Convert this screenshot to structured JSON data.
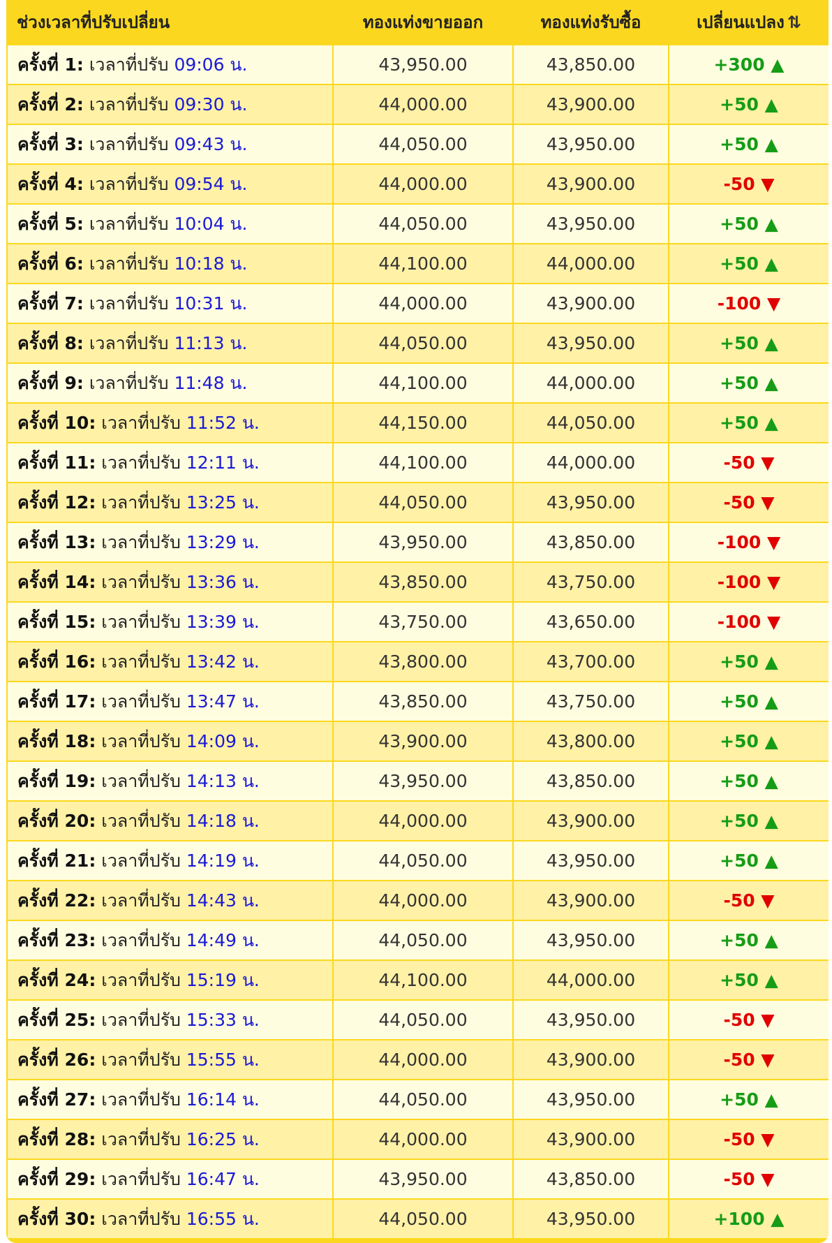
{
  "header": {
    "period": "ช่วงเวลาที่ปรับเปลี่ยน",
    "sell": "ทองแท่งขายออก",
    "buy": "ทองแท่งรับซื้อ",
    "change": "เปลี่ยนแปลง",
    "sort_icon": "⇅"
  },
  "colors": {
    "header_bg": "#fbd81f",
    "row_light": "#fffde0",
    "row_dark": "#fff1a6",
    "up": "#169c16",
    "down": "#e00000",
    "time": "#1a1ad6"
  },
  "time_label": "เวลาที่ปรับ",
  "rows": [
    {
      "round": "ครั้งที่ 1:",
      "time": "09:06 น.",
      "sell": "43,950.00",
      "buy": "43,850.00",
      "change": "+300 ▲",
      "dir": "up"
    },
    {
      "round": "ครั้งที่ 2:",
      "time": "09:30 น.",
      "sell": "44,000.00",
      "buy": "43,900.00",
      "change": "+50 ▲",
      "dir": "up"
    },
    {
      "round": "ครั้งที่ 3:",
      "time": "09:43 น.",
      "sell": "44,050.00",
      "buy": "43,950.00",
      "change": "+50 ▲",
      "dir": "up"
    },
    {
      "round": "ครั้งที่ 4:",
      "time": "09:54 น.",
      "sell": "44,000.00",
      "buy": "43,900.00",
      "change": "-50 ▼",
      "dir": "down"
    },
    {
      "round": "ครั้งที่ 5:",
      "time": "10:04 น.",
      "sell": "44,050.00",
      "buy": "43,950.00",
      "change": "+50 ▲",
      "dir": "up"
    },
    {
      "round": "ครั้งที่ 6:",
      "time": "10:18 น.",
      "sell": "44,100.00",
      "buy": "44,000.00",
      "change": "+50 ▲",
      "dir": "up"
    },
    {
      "round": "ครั้งที่ 7:",
      "time": "10:31 น.",
      "sell": "44,000.00",
      "buy": "43,900.00",
      "change": "-100 ▼",
      "dir": "down"
    },
    {
      "round": "ครั้งที่ 8:",
      "time": "11:13 น.",
      "sell": "44,050.00",
      "buy": "43,950.00",
      "change": "+50 ▲",
      "dir": "up"
    },
    {
      "round": "ครั้งที่ 9:",
      "time": "11:48 น.",
      "sell": "44,100.00",
      "buy": "44,000.00",
      "change": "+50 ▲",
      "dir": "up"
    },
    {
      "round": "ครั้งที่ 10:",
      "time": "11:52 น.",
      "sell": "44,150.00",
      "buy": "44,050.00",
      "change": "+50 ▲",
      "dir": "up"
    },
    {
      "round": "ครั้งที่ 11:",
      "time": "12:11 น.",
      "sell": "44,100.00",
      "buy": "44,000.00",
      "change": "-50 ▼",
      "dir": "down"
    },
    {
      "round": "ครั้งที่ 12:",
      "time": "13:25 น.",
      "sell": "44,050.00",
      "buy": "43,950.00",
      "change": "-50 ▼",
      "dir": "down"
    },
    {
      "round": "ครั้งที่ 13:",
      "time": "13:29 น.",
      "sell": "43,950.00",
      "buy": "43,850.00",
      "change": "-100 ▼",
      "dir": "down"
    },
    {
      "round": "ครั้งที่ 14:",
      "time": "13:36 น.",
      "sell": "43,850.00",
      "buy": "43,750.00",
      "change": "-100 ▼",
      "dir": "down"
    },
    {
      "round": "ครั้งที่ 15:",
      "time": "13:39 น.",
      "sell": "43,750.00",
      "buy": "43,650.00",
      "change": "-100 ▼",
      "dir": "down"
    },
    {
      "round": "ครั้งที่ 16:",
      "time": "13:42 น.",
      "sell": "43,800.00",
      "buy": "43,700.00",
      "change": "+50 ▲",
      "dir": "up"
    },
    {
      "round": "ครั้งที่ 17:",
      "time": "13:47 น.",
      "sell": "43,850.00",
      "buy": "43,750.00",
      "change": "+50 ▲",
      "dir": "up"
    },
    {
      "round": "ครั้งที่ 18:",
      "time": "14:09 น.",
      "sell": "43,900.00",
      "buy": "43,800.00",
      "change": "+50 ▲",
      "dir": "up"
    },
    {
      "round": "ครั้งที่ 19:",
      "time": "14:13 น.",
      "sell": "43,950.00",
      "buy": "43,850.00",
      "change": "+50 ▲",
      "dir": "up"
    },
    {
      "round": "ครั้งที่ 20:",
      "time": "14:18 น.",
      "sell": "44,000.00",
      "buy": "43,900.00",
      "change": "+50 ▲",
      "dir": "up"
    },
    {
      "round": "ครั้งที่ 21:",
      "time": "14:19 น.",
      "sell": "44,050.00",
      "buy": "43,950.00",
      "change": "+50 ▲",
      "dir": "up"
    },
    {
      "round": "ครั้งที่ 22:",
      "time": "14:43 น.",
      "sell": "44,000.00",
      "buy": "43,900.00",
      "change": "-50 ▼",
      "dir": "down"
    },
    {
      "round": "ครั้งที่ 23:",
      "time": "14:49 น.",
      "sell": "44,050.00",
      "buy": "43,950.00",
      "change": "+50 ▲",
      "dir": "up"
    },
    {
      "round": "ครั้งที่ 24:",
      "time": "15:19 น.",
      "sell": "44,100.00",
      "buy": "44,000.00",
      "change": "+50 ▲",
      "dir": "up"
    },
    {
      "round": "ครั้งที่ 25:",
      "time": "15:33 น.",
      "sell": "44,050.00",
      "buy": "43,950.00",
      "change": "-50 ▼",
      "dir": "down"
    },
    {
      "round": "ครั้งที่ 26:",
      "time": "15:55 น.",
      "sell": "44,000.00",
      "buy": "43,900.00",
      "change": "-50 ▼",
      "dir": "down"
    },
    {
      "round": "ครั้งที่ 27:",
      "time": "16:14 น.",
      "sell": "44,050.00",
      "buy": "43,950.00",
      "change": "+50 ▲",
      "dir": "up"
    },
    {
      "round": "ครั้งที่ 28:",
      "time": "16:25 น.",
      "sell": "44,000.00",
      "buy": "43,900.00",
      "change": "-50 ▼",
      "dir": "down"
    },
    {
      "round": "ครั้งที่ 29:",
      "time": "16:47 น.",
      "sell": "43,950.00",
      "buy": "43,850.00",
      "change": "-50 ▼",
      "dir": "down"
    },
    {
      "round": "ครั้งที่ 30:",
      "time": "16:55 น.",
      "sell": "44,050.00",
      "buy": "43,950.00",
      "change": "+100 ▲",
      "dir": "up"
    }
  ]
}
